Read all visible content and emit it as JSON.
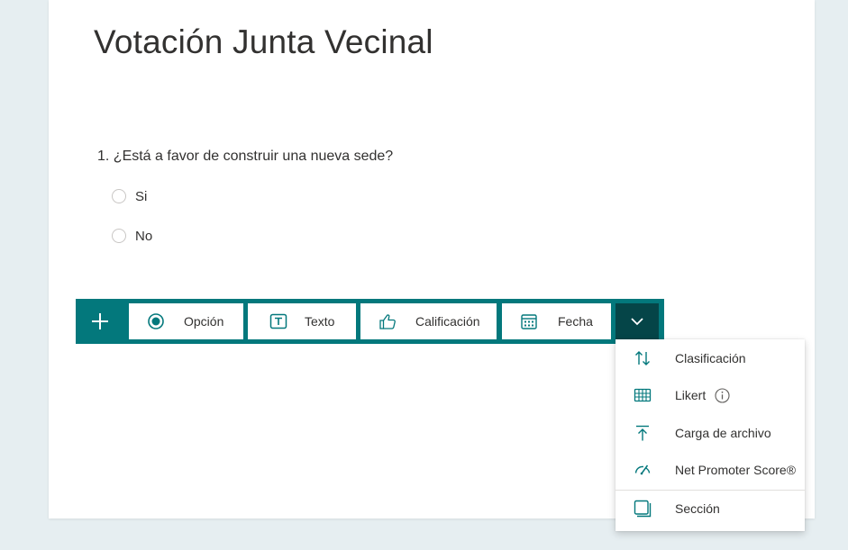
{
  "form": {
    "title": "Votación Junta Vecinal"
  },
  "question": {
    "text": "1. ¿Está a favor de construir una nueva sede?",
    "options": [
      "Si",
      "No"
    ]
  },
  "toolbar": {
    "add_icon": "plus-icon",
    "types": [
      {
        "label": "Opción",
        "icon": "radio-icon"
      },
      {
        "label": "Texto",
        "icon": "text-icon"
      },
      {
        "label": "Calificación",
        "icon": "thumbs-up-icon"
      },
      {
        "label": "Fecha",
        "icon": "calendar-icon"
      }
    ],
    "more_icon": "chevron-down-icon"
  },
  "more_menu": {
    "items": [
      {
        "label": "Clasificación",
        "icon": "ranking-icon"
      },
      {
        "label": "Likert",
        "icon": "likert-icon"
      },
      {
        "label": "Carga de archivo",
        "icon": "upload-icon"
      },
      {
        "label": "Net Promoter Score®",
        "icon": "gauge-icon"
      },
      {
        "label": "Sección",
        "icon": "section-icon"
      }
    ]
  },
  "colors": {
    "accent": "#03787c",
    "accent_dark": "#054548",
    "background": "#e6eef1"
  }
}
